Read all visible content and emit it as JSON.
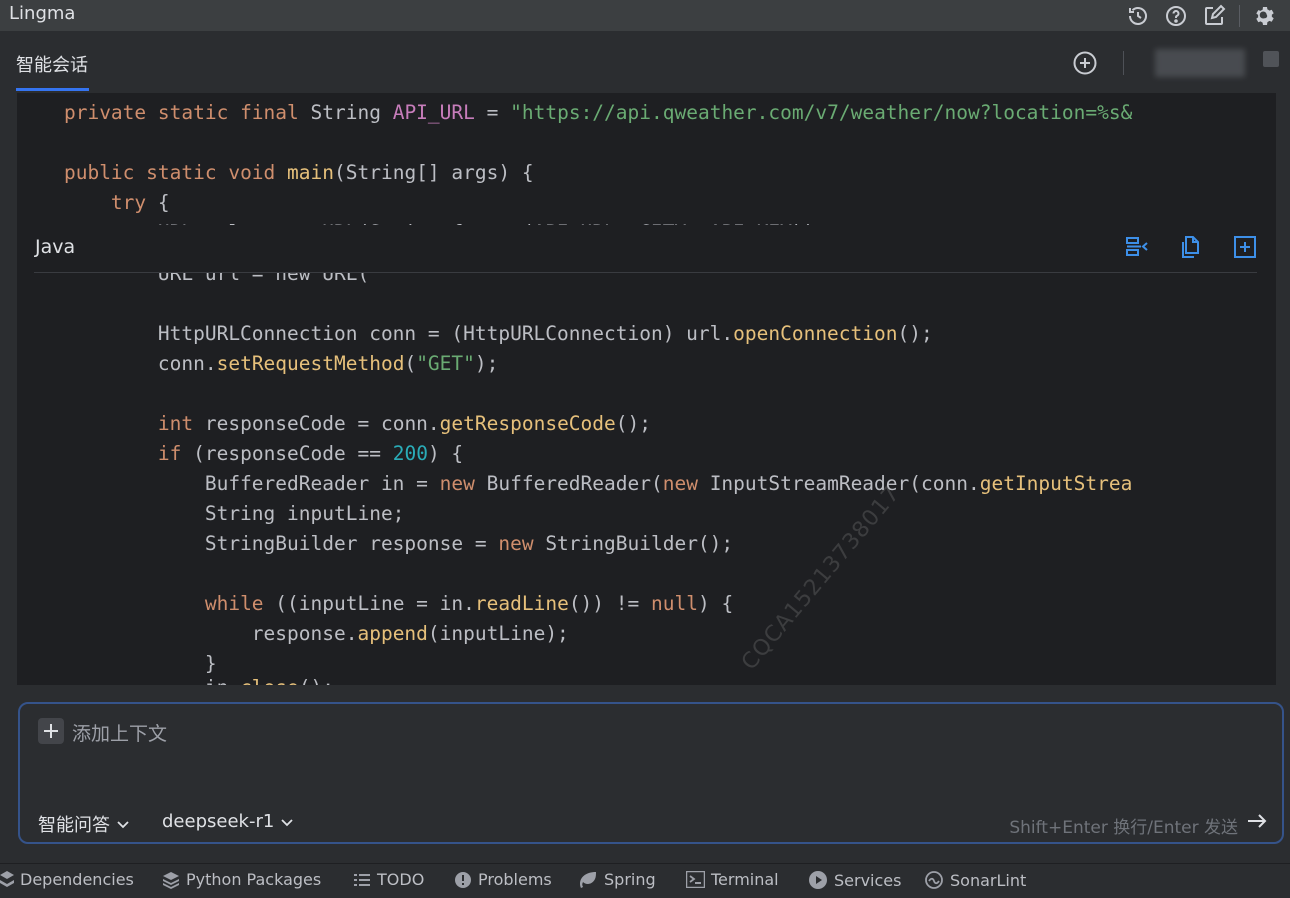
{
  "titlebar": {
    "title": "Lingma",
    "icons": [
      "history-icon",
      "help-icon",
      "edit-icon",
      "settings-icon"
    ]
  },
  "tabs": {
    "active_label": "智能会话"
  },
  "code_top_lines": [
    "    private static final String API_URL = \"https://api.qweather.com/v7/weather/now?location=%s&",
    "",
    "    public static void main(String[] args) {",
    "        try {"
  ],
  "code_block": {
    "language": "Java",
    "actions": [
      "insert-icon",
      "copy-icon",
      "new-file-icon"
    ],
    "lines": [
      "",
      "            HttpURLConnection conn = (HttpURLConnection) url.openConnection();",
      "            conn.setRequestMethod(\"GET\");",
      "",
      "            int responseCode = conn.getResponseCode();",
      "            if (responseCode == 200) {",
      "                BufferedReader in = new BufferedReader(new InputStreamReader(conn.getInputStrea",
      "                String inputLine;",
      "                StringBuilder response = new StringBuilder();",
      "",
      "                while ((inputLine = in.readLine()) != null) {",
      "                    response.append(inputLine);",
      "                }",
      "                in.close();"
    ],
    "watermark": "CQCA15213738017"
  },
  "input": {
    "add_context_label": "添加上下文",
    "mode": "智能问答",
    "model": "deepseek-r1",
    "hint": "Shift+Enter 换行/Enter 发送"
  },
  "toolbar": {
    "items": [
      {
        "label": "Dependencies",
        "icon": "dependencies-icon"
      },
      {
        "label": "Python Packages",
        "icon": "packages-icon"
      },
      {
        "label": "TODO",
        "icon": "todo-icon"
      },
      {
        "label": "Problems",
        "icon": "problems-icon"
      },
      {
        "label": "Spring",
        "icon": "spring-icon"
      },
      {
        "label": "Terminal",
        "icon": "terminal-icon"
      },
      {
        "label": "Services",
        "icon": "services-icon"
      },
      {
        "label": "SonarLint",
        "icon": "sonarlint-icon"
      }
    ]
  },
  "colors": {
    "accent": "#3574f0",
    "keyword": "#cf8e6d",
    "string": "#6aab73",
    "method": "#e6c07b",
    "number": "#2aacb8"
  }
}
